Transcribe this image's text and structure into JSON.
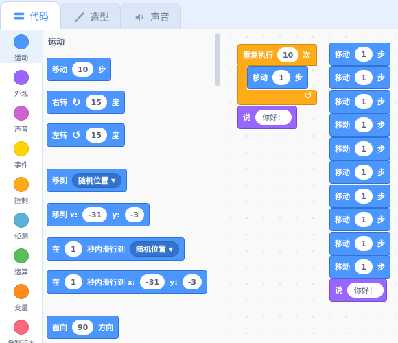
{
  "tabs": [
    {
      "label": "代码",
      "icon": "code-icon"
    },
    {
      "label": "造型",
      "icon": "brush-icon"
    },
    {
      "label": "声音",
      "icon": "speaker-icon"
    }
  ],
  "categories": [
    {
      "label": "运动",
      "color": "#4c97ff"
    },
    {
      "label": "外观",
      "color": "#9966ff"
    },
    {
      "label": "声音",
      "color": "#cf63cf"
    },
    {
      "label": "事件",
      "color": "#ffd500"
    },
    {
      "label": "控制",
      "color": "#ffab19"
    },
    {
      "label": "侦测",
      "color": "#5cb1d6"
    },
    {
      "label": "运算",
      "color": "#59c059"
    },
    {
      "label": "变量",
      "color": "#ff8c1a"
    },
    {
      "label": "自制积木",
      "color": "#ff6680"
    }
  ],
  "palette": {
    "title": "运动",
    "move": {
      "label": "移动",
      "value": "10",
      "unit": "步"
    },
    "turn_right": {
      "label": "右转",
      "value": "15",
      "unit": "度"
    },
    "turn_left": {
      "label": "左转",
      "value": "15",
      "unit": "度"
    },
    "goto": {
      "label": "移到",
      "option": "随机位置"
    },
    "goto_xy": {
      "label": "移到 x:",
      "x": "-31",
      "ylabel": "y:",
      "y": "-3"
    },
    "glide": {
      "prefix": "在",
      "secs": "1",
      "mid": "秒内滑行到",
      "option": "随机位置"
    },
    "glide_xy": {
      "prefix": "在",
      "secs": "1",
      "mid": "秒内滑行到 x:",
      "x": "-31",
      "ylabel": "y:",
      "y": "-3"
    },
    "point": {
      "label": "面向",
      "value": "90",
      "unit": "方向"
    }
  },
  "workspace": {
    "repeat": {
      "label": "重复执行",
      "times": "10",
      "unit": "次"
    },
    "inner_move": {
      "label": "移动",
      "value": "1",
      "unit": "步"
    },
    "say1": {
      "label": "说",
      "text": "你好！"
    },
    "move_stack": [
      {
        "label": "移动",
        "value": "1",
        "unit": "步"
      },
      {
        "label": "移动",
        "value": "1",
        "unit": "步"
      },
      {
        "label": "移动",
        "value": "1",
        "unit": "步"
      },
      {
        "label": "移动",
        "value": "1",
        "unit": "步"
      },
      {
        "label": "移动",
        "value": "1",
        "unit": "步"
      },
      {
        "label": "移动",
        "value": "1",
        "unit": "步"
      },
      {
        "label": "移动",
        "value": "1",
        "unit": "步"
      },
      {
        "label": "移动",
        "value": "1",
        "unit": "步"
      },
      {
        "label": "移动",
        "value": "1",
        "unit": "步"
      },
      {
        "label": "移动",
        "value": "1",
        "unit": "步"
      }
    ],
    "say2": {
      "label": "说",
      "text": "你好！"
    }
  }
}
